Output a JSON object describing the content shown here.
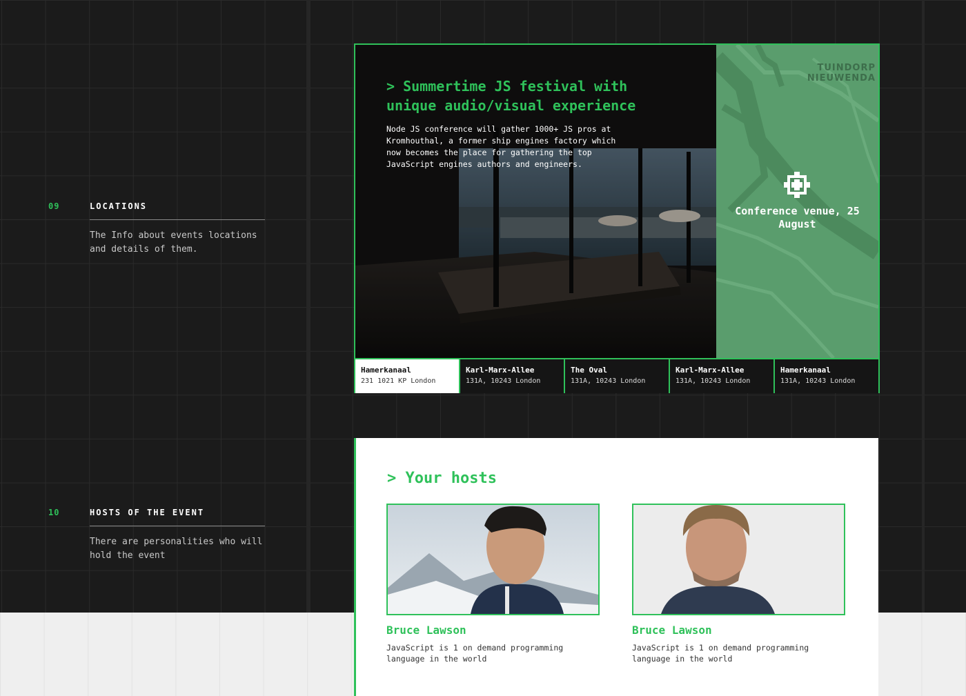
{
  "colors": {
    "accent": "#2fc15a",
    "dark_bg": "#1b1b1b",
    "map_green": "#5a9d6d"
  },
  "sections": [
    {
      "number": "09",
      "title": "LOCATIONS",
      "description": "The Info about events locations and details of them."
    },
    {
      "number": "10",
      "title": "HOSTS OF THE EVENT",
      "description": "There are personalities who will hold the event"
    }
  ],
  "location": {
    "heading": "> Summertime JS festival with unique audio/visual experience",
    "text": "Node JS conference will gather 1000+ JS pros at Kromhouthal, a former ship engines factory which now becomes the place for gathering the top JavaScript engines authors and engineers.",
    "map_label": "TUINDORP NIEUWENDA",
    "venue_icon": "target-icon",
    "venue_caption": "Conference venue, 25 August",
    "tabs": [
      {
        "name": "Hamerkanaal",
        "address": "231 1021 KP London",
        "active": true
      },
      {
        "name": "Karl-Marx-Allee",
        "address": "131A, 10243 London",
        "active": false
      },
      {
        "name": "The Oval",
        "address": "131A, 10243 London",
        "active": false
      },
      {
        "name": "Karl-Marx-Allee",
        "address": "131A, 10243 London",
        "active": false
      },
      {
        "name": "Hamerkanaal",
        "address": "131A, 10243 London",
        "active": false
      }
    ]
  },
  "hosts": {
    "heading": "> Your hosts",
    "people": [
      {
        "name": "Bruce Lawson",
        "bio": "JavaScript is 1 on demand programming language in the world"
      },
      {
        "name": "Bruce Lawson",
        "bio": "JavaScript is 1 on demand programming language in the world"
      }
    ]
  }
}
